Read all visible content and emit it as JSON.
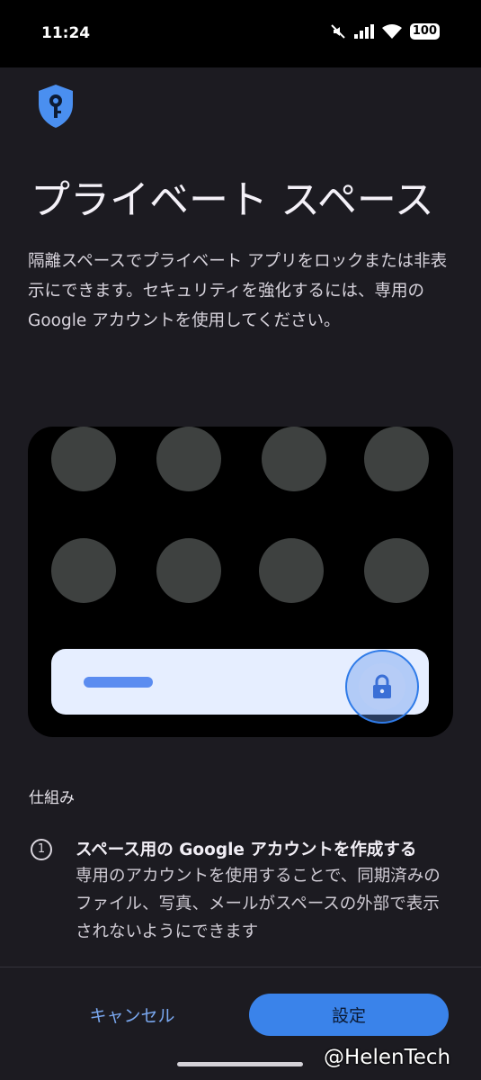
{
  "status_bar": {
    "time": "11:24",
    "battery": "100",
    "icons": [
      "mute-icon",
      "signal-icon",
      "wifi-icon",
      "battery-icon"
    ]
  },
  "header": {
    "icon": "shield-key-icon",
    "title": "プライベート スペース",
    "description": "隔離スペースでプライベート アプリをロックまたは非表示にできます。セキュリティを強化するには、専用の Google アカウントを使用してください。"
  },
  "illustration": {
    "icon": "lock-icon"
  },
  "how_it_works": {
    "label": "仕組み",
    "steps": [
      {
        "number": "1",
        "title": "スペース用の Google アカウントを作成する",
        "body": "専用のアカウントを使用することで、同期済みのファイル、写真、メールがスペースの外部で表示されないようにできます"
      }
    ]
  },
  "actions": {
    "cancel_label": "キャンセル",
    "setup_label": "設定"
  },
  "watermark": "@HelenTech",
  "colors": {
    "background": "#1c1b21",
    "accent": "#3a83ea",
    "link": "#7aa8f0",
    "shield": "#4a8ff0"
  }
}
